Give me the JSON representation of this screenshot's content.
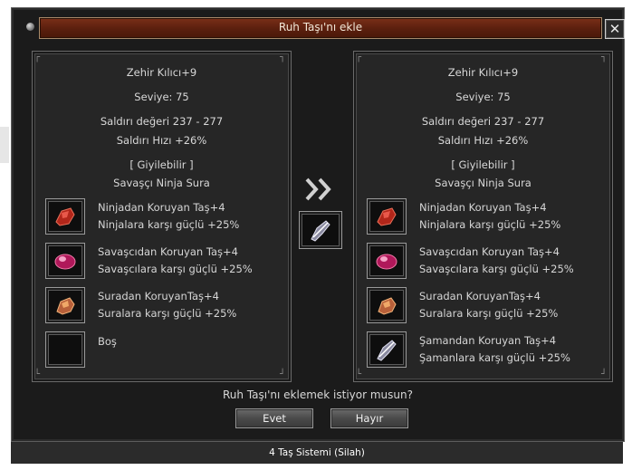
{
  "dialog": {
    "title": "Ruh Taşı'nı ekle",
    "close_label": "✕",
    "question": "Ruh Taşı'nı eklemek istiyor musun?",
    "yes_label": "Evet",
    "no_label": "Hayır"
  },
  "left_panel": {
    "item_name": "Zehir Kılıcı+9",
    "level": "Seviye: 75",
    "attack": "Saldırı değeri 237 - 277",
    "attack_speed": "Saldırı Hızı +26%",
    "wearable": "[ Giyilebilir ]",
    "classes": "Savaşçı Ninja Sura",
    "stones": [
      {
        "name": "Ninjadan Koruyan Taş+4",
        "effect": "Ninjalara karşı güçlü +25%",
        "icon": "red-stone-icon"
      },
      {
        "name": "Savaşcıdan Koruyan Taş+4",
        "effect": "Savaşcılara karşı güçlü +25%",
        "icon": "pink-stone-icon"
      },
      {
        "name": "Suradan KoruyanTaş+4",
        "effect": "Suralara karşı güçlü +25%",
        "icon": "orange-stone-icon"
      },
      {
        "name": "Boş",
        "effect": "",
        "icon": "empty-slot"
      }
    ]
  },
  "right_panel": {
    "item_name": "Zehir Kılıcı+9",
    "level": "Seviye: 75",
    "attack": "Saldırı değeri 237 - 277",
    "attack_speed": "Saldırı Hızı +26%",
    "wearable": "[ Giyilebilir ]",
    "classes": "Savaşçı Ninja Sura",
    "stones": [
      {
        "name": "Ninjadan Koruyan Taş+4",
        "effect": "Ninjalara karşı güçlü +25%",
        "icon": "red-stone-icon"
      },
      {
        "name": "Savaşcıdan Koruyan Taş+4",
        "effect": "Savaşcılara karşı güçlü +25%",
        "icon": "pink-stone-icon"
      },
      {
        "name": "Suradan KoruyanTaş+4",
        "effect": "Suralara karşı güçlü +25%",
        "icon": "orange-stone-icon"
      },
      {
        "name": "Şamandan Koruyan Taş+4",
        "effect": "Şamanlara karşı güçlü +25%",
        "icon": "shaman-stone-icon"
      }
    ]
  },
  "middle": {
    "arrow_icon": "double-chevron-right-icon",
    "stone_icon": "shaman-stone-icon"
  },
  "caption": "4 Taş Sistemi (Silah)",
  "colors": {
    "title_bar": "#6a2812",
    "panel_bg": "#262626",
    "text": "#d8d8d8"
  }
}
